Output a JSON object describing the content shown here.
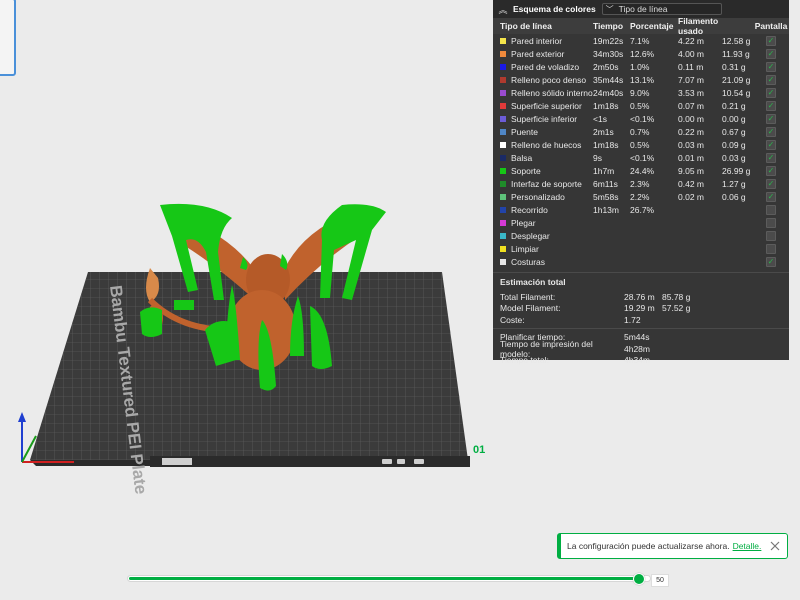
{
  "legend": {
    "title": "Esquema de colores",
    "selector_value": "Tipo de línea",
    "columns": [
      "Tipo de línea",
      "Tiempo",
      "Porcentaje",
      "Filamento usado",
      "",
      "Pantalla"
    ],
    "rows": [
      {
        "name": "Pared interior",
        "time": "19m22s",
        "pct": "7.1%",
        "len": "4.22 m",
        "wt": "12.58 g",
        "color": "#f4e54b",
        "shown": true
      },
      {
        "name": "Pared exterior",
        "time": "34m30s",
        "pct": "12.6%",
        "len": "4.00 m",
        "wt": "11.93 g",
        "color": "#f08a3c",
        "shown": true
      },
      {
        "name": "Pared de voladizo",
        "time": "2m50s",
        "pct": "1.0%",
        "len": "0.11 m",
        "wt": "0.31 g",
        "color": "#1a1ae6",
        "shown": true
      },
      {
        "name": "Relleno poco denso",
        "time": "35m44s",
        "pct": "13.1%",
        "len": "7.07 m",
        "wt": "21.09 g",
        "color": "#b03a2e",
        "shown": true
      },
      {
        "name": "Relleno sólido interno",
        "time": "24m40s",
        "pct": "9.0%",
        "len": "3.53 m",
        "wt": "10.54 g",
        "color": "#9a4bd0",
        "shown": true
      },
      {
        "name": "Superficie superior",
        "time": "1m18s",
        "pct": "0.5%",
        "len": "0.07 m",
        "wt": "0.21 g",
        "color": "#e03a3a",
        "shown": true
      },
      {
        "name": "Superficie inferior",
        "time": "<1s",
        "pct": "<0.1%",
        "len": "0.00 m",
        "wt": "0.00 g",
        "color": "#6c5cd8",
        "shown": true
      },
      {
        "name": "Puente",
        "time": "2m1s",
        "pct": "0.7%",
        "len": "0.22 m",
        "wt": "0.67 g",
        "color": "#4f86c6",
        "shown": true
      },
      {
        "name": "Relleno de huecos",
        "time": "1m18s",
        "pct": "0.5%",
        "len": "0.03 m",
        "wt": "0.09 g",
        "color": "#ffffff",
        "shown": true
      },
      {
        "name": "Balsa",
        "time": "9s",
        "pct": "<0.1%",
        "len": "0.01 m",
        "wt": "0.03 g",
        "color": "#1a2a66",
        "shown": true
      },
      {
        "name": "Soporte",
        "time": "1h7m",
        "pct": "24.4%",
        "len": "9.05 m",
        "wt": "26.99 g",
        "color": "#16c716",
        "shown": true
      },
      {
        "name": "Interfaz de soporte",
        "time": "6m11s",
        "pct": "2.3%",
        "len": "0.42 m",
        "wt": "1.27 g",
        "color": "#1f8c2a",
        "shown": true
      },
      {
        "name": "Personalizado",
        "time": "5m58s",
        "pct": "2.2%",
        "len": "0.02 m",
        "wt": "0.06 g",
        "color": "#5ec27a",
        "shown": true
      },
      {
        "name": "Recorrido",
        "time": "1h13m",
        "pct": "26.7%",
        "len": "",
        "wt": "",
        "color": "#2244aa",
        "shown": false
      },
      {
        "name": "Plegar",
        "time": "",
        "pct": "",
        "len": "",
        "wt": "",
        "color": "#d63ad6",
        "shown": false
      },
      {
        "name": "Desplegar",
        "time": "",
        "pct": "",
        "len": "",
        "wt": "",
        "color": "#3ab8c8",
        "shown": false
      },
      {
        "name": "Limpiar",
        "time": "",
        "pct": "",
        "len": "",
        "wt": "",
        "color": "#f0e020",
        "shown": false
      },
      {
        "name": "Costuras",
        "time": "",
        "pct": "",
        "len": "",
        "wt": "",
        "color": "#e6e6e6",
        "shown": true
      }
    ],
    "estimation_title": "Estimación total",
    "estimation": [
      {
        "label": "Total Filament:",
        "v1": "28.76 m",
        "v2": "85.78 g"
      },
      {
        "label": "Model Filament:",
        "v1": "19.29 m",
        "v2": "57.52 g"
      },
      {
        "label": "Coste:",
        "v1": "1.72",
        "v2": ""
      }
    ],
    "times": [
      {
        "label": "Planificar tiempo:",
        "v1": "5m44s"
      },
      {
        "label": "Tiempo de impresión del modelo:",
        "v1": "4h28m"
      },
      {
        "label": "Tiempo total:",
        "v1": "4h34m"
      }
    ]
  },
  "plate": {
    "number": "01",
    "bed_label": "Bambu Textured PEI Plate"
  },
  "notification": {
    "message": "La configuración puede actualizarse ahora.",
    "link": "Detalle."
  },
  "layer_slider": {
    "value": "50",
    "fraction": 0.98
  },
  "colors": {
    "accent": "#00ae42",
    "support": "#16c716",
    "model": "#c0622d",
    "panel": "#363636"
  }
}
